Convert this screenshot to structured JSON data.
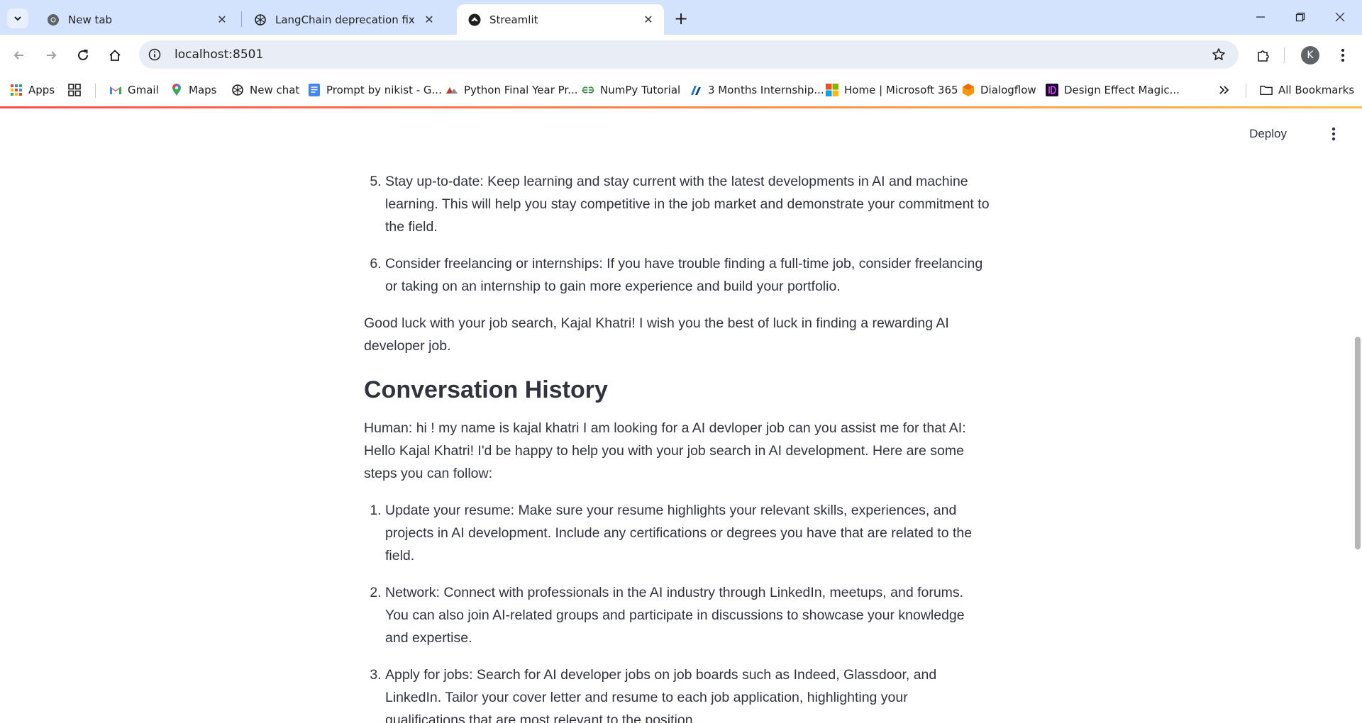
{
  "browser": {
    "tabs": [
      {
        "label": "New tab",
        "icon": "chrome-icon",
        "active": false
      },
      {
        "label": "LangChain deprecation fix",
        "icon": "openai-icon",
        "active": false
      },
      {
        "label": "Streamlit",
        "icon": "streamlit-icon",
        "active": true
      }
    ],
    "url": "localhost:8501",
    "profile_initial": "K",
    "bookmarks": [
      {
        "label": "Apps",
        "icon": "apps-grid-icon"
      },
      {
        "label": "Gmail",
        "icon": "gmail-icon"
      },
      {
        "label": "Maps",
        "icon": "maps-icon"
      },
      {
        "label": "New chat",
        "icon": "openai-icon"
      },
      {
        "label": "Prompt by nikist - G...",
        "icon": "docs-icon"
      },
      {
        "label": "Python Final Year Pr...",
        "icon": "python-project-icon"
      },
      {
        "label": "NumPy Tutorial",
        "icon": "geeksforgeeks-icon"
      },
      {
        "label": "3 Months Internship...",
        "icon": "internship-icon"
      },
      {
        "label": "Home | Microsoft 365",
        "icon": "microsoft-icon"
      },
      {
        "label": "Dialogflow",
        "icon": "dialogflow-icon"
      },
      {
        "label": "Design Effect Magic...",
        "icon": "design-effect-icon"
      }
    ],
    "all_bookmarks": "All Bookmarks"
  },
  "app": {
    "deploy_label": "Deploy",
    "top_items": [
      {
        "number": "5.",
        "text": "Stay up-to-date: Keep learning and stay current with the latest developments in AI and machine learning. This will help you stay competitive in the job market and demonstrate your commitment to the field."
      },
      {
        "number": "6.",
        "text": "Consider freelancing or internships: If you have trouble finding a full-time job, consider freelancing or taking on an internship to gain more experience and build your portfolio."
      }
    ],
    "closing": "Good luck with your job search, Kajal Khatri! I wish you the best of luck in finding a rewarding AI developer job.",
    "history_heading": "Conversation History",
    "history_intro": "Human: hi ! my name is kajal khatri I am looking for a AI devloper job can you assist me for that AI: Hello Kajal Khatri! I'd be happy to help you with your job search in AI development. Here are some steps you can follow:",
    "history_items": [
      {
        "number": "1.",
        "text": "Update your resume: Make sure your resume highlights your relevant skills, experiences, and projects in AI development. Include any certifications or degrees you have that are related to the field."
      },
      {
        "number": "2.",
        "text": "Network: Connect with professionals in the AI industry through LinkedIn, meetups, and forums. You can also join AI-related groups and participate in discussions to showcase your knowledge and expertise."
      },
      {
        "number": "3.",
        "text": "Apply for jobs: Search for AI developer jobs on job boards such as Indeed, Glassdoor, and LinkedIn. Tailor your cover letter and resume to each job application, highlighting your qualifications that are most relevant to the position."
      }
    ]
  }
}
